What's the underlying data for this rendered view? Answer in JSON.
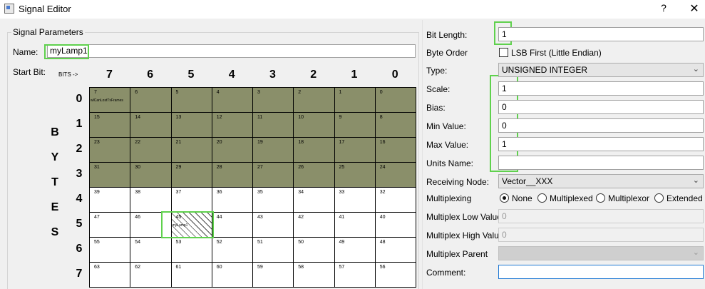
{
  "window": {
    "title": "Signal Editor",
    "help": "?",
    "close": "✕"
  },
  "group": {
    "title": "Signal Parameters"
  },
  "name": {
    "label": "Name:",
    "value": "myLamp1"
  },
  "start_bit": {
    "label": "Start Bit:",
    "bits_arrow": "BITS ->"
  },
  "bit_headers": [
    "7",
    "6",
    "5",
    "4",
    "3",
    "2",
    "1",
    "0"
  ],
  "byte_numbers": [
    "0",
    "1",
    "2",
    "3",
    "4",
    "5",
    "6",
    "7"
  ],
  "bytes_letters": [
    "B",
    "Y",
    "T",
    "E",
    "S"
  ],
  "grid_rows": [
    [
      {
        "n": "7",
        "used": true,
        "sig": "wlCanLostTxFrames"
      },
      {
        "n": "6",
        "used": true
      },
      {
        "n": "5",
        "used": true
      },
      {
        "n": "4",
        "used": true
      },
      {
        "n": "3",
        "used": true
      },
      {
        "n": "2",
        "used": true
      },
      {
        "n": "1",
        "used": true
      },
      {
        "n": "0",
        "used": true
      }
    ],
    [
      {
        "n": "15",
        "used": true
      },
      {
        "n": "14",
        "used": true
      },
      {
        "n": "13",
        "used": true
      },
      {
        "n": "12",
        "used": true
      },
      {
        "n": "11",
        "used": true
      },
      {
        "n": "10",
        "used": true
      },
      {
        "n": "9",
        "used": true
      },
      {
        "n": "8",
        "used": true
      }
    ],
    [
      {
        "n": "23",
        "used": true
      },
      {
        "n": "22",
        "used": true
      },
      {
        "n": "21",
        "used": true
      },
      {
        "n": "20",
        "used": true
      },
      {
        "n": "19",
        "used": true
      },
      {
        "n": "18",
        "used": true
      },
      {
        "n": "17",
        "used": true
      },
      {
        "n": "16",
        "used": true
      }
    ],
    [
      {
        "n": "31",
        "used": true
      },
      {
        "n": "30",
        "used": true
      },
      {
        "n": "29",
        "used": true
      },
      {
        "n": "28",
        "used": true
      },
      {
        "n": "27",
        "used": true
      },
      {
        "n": "26",
        "used": true
      },
      {
        "n": "25",
        "used": true
      },
      {
        "n": "24",
        "used": true
      }
    ],
    [
      {
        "n": "39"
      },
      {
        "n": "38"
      },
      {
        "n": "37"
      },
      {
        "n": "36"
      },
      {
        "n": "35"
      },
      {
        "n": "34"
      },
      {
        "n": "33"
      },
      {
        "n": "32"
      }
    ],
    [
      {
        "n": "47"
      },
      {
        "n": "46"
      },
      {
        "n": "45",
        "hatched": true,
        "sig": "myLamp1"
      },
      {
        "n": "44"
      },
      {
        "n": "43"
      },
      {
        "n": "42"
      },
      {
        "n": "41"
      },
      {
        "n": "40"
      }
    ],
    [
      {
        "n": "55"
      },
      {
        "n": "54"
      },
      {
        "n": "53"
      },
      {
        "n": "52"
      },
      {
        "n": "51"
      },
      {
        "n": "50"
      },
      {
        "n": "49"
      },
      {
        "n": "48"
      }
    ],
    [
      {
        "n": "63"
      },
      {
        "n": "62"
      },
      {
        "n": "61"
      },
      {
        "n": "60"
      },
      {
        "n": "59"
      },
      {
        "n": "58"
      },
      {
        "n": "57"
      },
      {
        "n": "56"
      }
    ]
  ],
  "colors": {
    "used_cell": "#8a8f6a",
    "highlight": "#5fd14d",
    "focus": "#1e78d4"
  },
  "fields": {
    "bit_length": {
      "label": "Bit Length:",
      "value": "1"
    },
    "byte_order": {
      "label": "Byte Order",
      "checkbox": "LSB First (Little Endian)"
    },
    "type": {
      "label": "Type:",
      "value": "UNSIGNED INTEGER"
    },
    "scale": {
      "label": "Scale:",
      "value": "1"
    },
    "bias": {
      "label": "Bias:",
      "value": "0"
    },
    "min_value": {
      "label": "Min Value:",
      "value": "0"
    },
    "max_value": {
      "label": "Max Value:",
      "value": "1"
    },
    "units_name": {
      "label": "Units Name:",
      "value": ""
    },
    "receiving_node": {
      "label": "Receiving Node:",
      "value": "Vector__XXX"
    },
    "multiplexing": {
      "label": "Multiplexing",
      "options": [
        "None",
        "Multiplexed",
        "Multiplexor",
        "Extended"
      ],
      "selected": "None"
    },
    "mux_low": {
      "label": "Multiplex Low Value",
      "value": "0"
    },
    "mux_high": {
      "label": "Multiplex High Value",
      "value": "0"
    },
    "mux_parent": {
      "label": "Multiplex Parent",
      "value": ""
    },
    "comment": {
      "label": "Comment:",
      "value": ""
    }
  }
}
